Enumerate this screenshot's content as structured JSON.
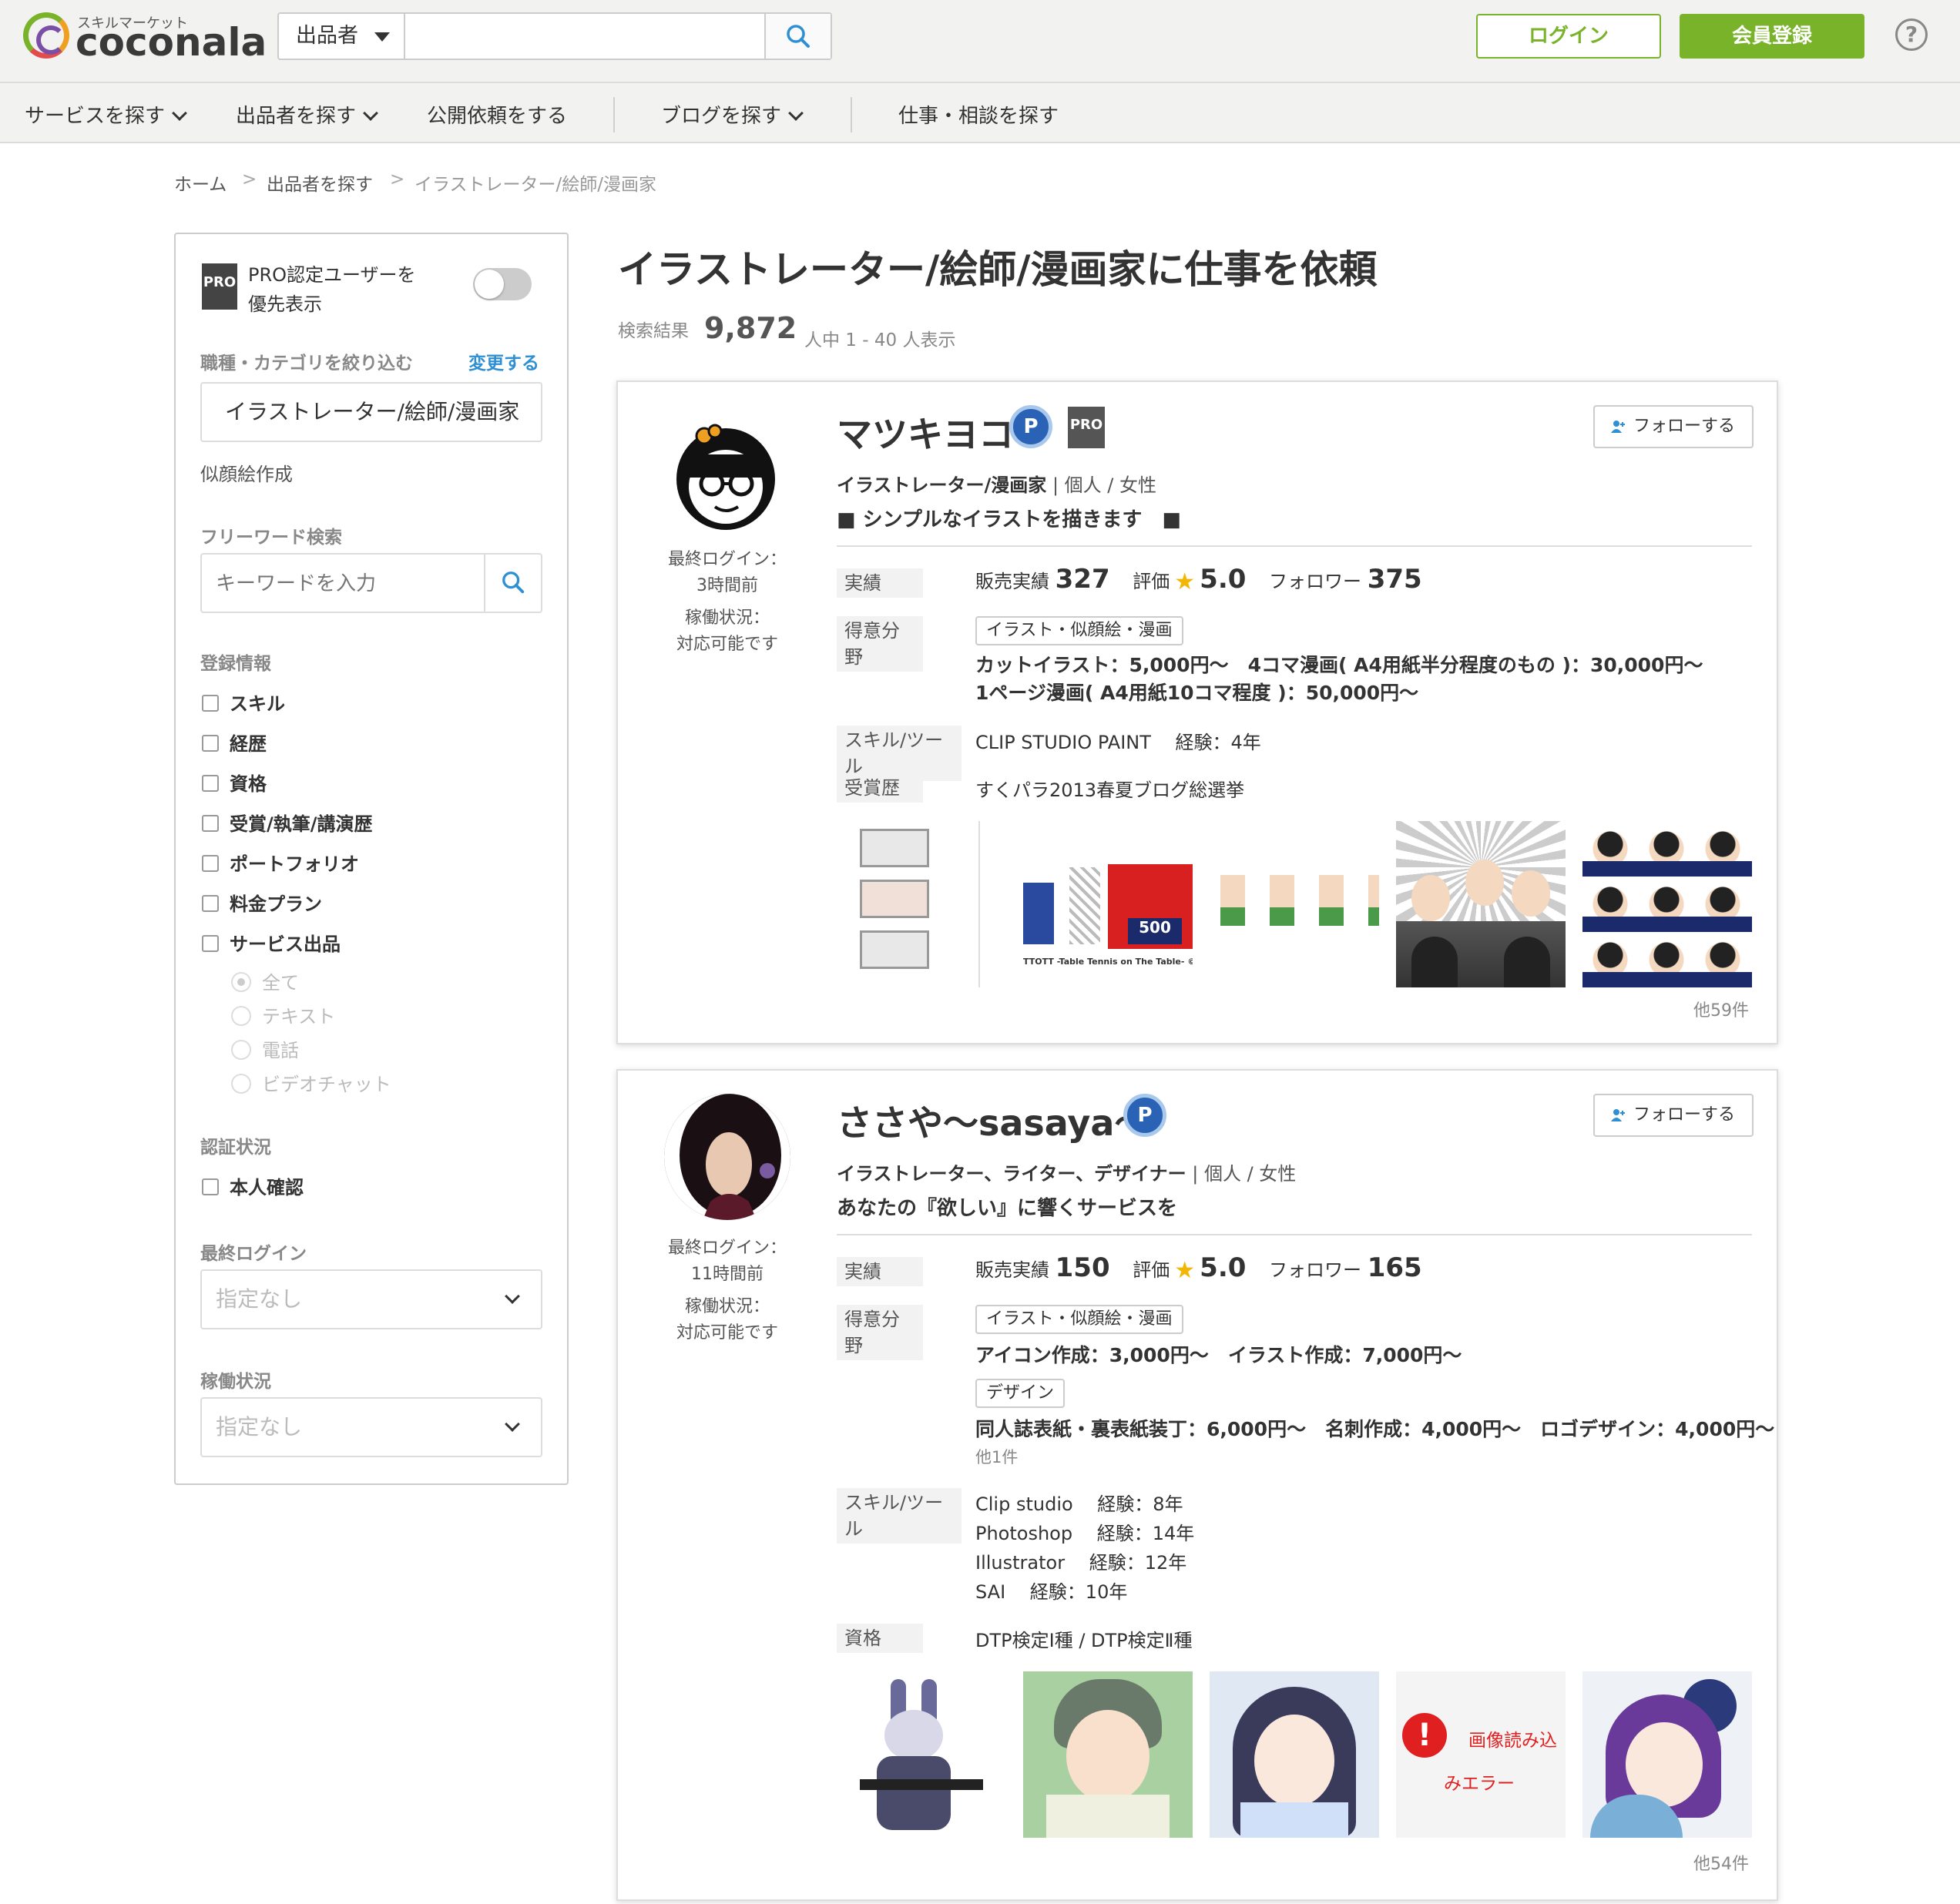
{
  "header": {
    "logo_sub": "スキルマーケット",
    "logo_text": "coconala",
    "search_type": "出品者",
    "login_label": "ログイン",
    "register_label": "会員登録",
    "help": "?",
    "brand_color": "#79b32a"
  },
  "nav": {
    "items": [
      "サービスを探す",
      "出品者を探す",
      "公開依頼をする",
      "ブログを探す",
      "仕事・相談を探す"
    ]
  },
  "breadcrumb": [
    "ホーム",
    ">",
    "出品者を探す",
    ">",
    "イラストレーター/絵師/漫画家"
  ],
  "sidebar": {
    "pro_toggle_label_1": "PRO認定ユーザーを",
    "pro_toggle_label_2": "優先表示",
    "pro_icon": "PRO",
    "category_label": "職種・カテゴリを絞り込む",
    "category_change": "変更する",
    "category_value": "イラストレーター/絵師/漫画家",
    "subcategory": "似顔絵作成",
    "freeword_label": "フリーワード検索",
    "freeword_placeholder": "キーワードを入力",
    "registration_label": "登録情報",
    "registration_items": [
      "スキル",
      "経歴",
      "資格",
      "受賞/執筆/講演歴",
      "ポートフォリオ",
      "料金プラン",
      "サービス出品"
    ],
    "service_types": [
      "全て",
      "テキスト",
      "電話",
      "ビデオチャット"
    ],
    "auth_label": "認証状況",
    "auth_item": "本人確認",
    "last_login_label": "最終ログイン",
    "last_login_value": "指定なし",
    "status_label": "稼働状況",
    "status_value": "指定なし"
  },
  "main": {
    "title": "イラストレーター/絵師/漫画家に仕事を依頼",
    "result_prefix": "検索結果",
    "result_count": "9,872",
    "result_suffix": "人中 1 - 40 人表示"
  },
  "cards": [
    {
      "name": "マツキヨコ",
      "pro_badge": "PRO",
      "rank_badge": "P",
      "follow": "フォローする",
      "role": "イラストレーター/漫画家",
      "type": "| 個人 / 女性",
      "catch": "■ シンプルなイラストを描きます　■",
      "last_login_label": "最終ログイン：",
      "last_login": "3時間前",
      "status_label": "稼働状況：",
      "status": "対応可能です",
      "stats_label": "実績",
      "sales_label": "販売実績",
      "sales": "327",
      "rating_label": "評価",
      "rating": "5.0",
      "followers_label": "フォロワー",
      "followers": "375",
      "field_label": "得意分野",
      "field_tag": "イラスト・似顔絵・漫画",
      "field_line1": "カットイラスト：5,000円〜　4コマ漫画( A4用紙半分程度のもの )：30,000円〜",
      "field_line2": "1ページ漫画( A4用紙10コマ程度 )：50,000円〜",
      "skill_label": "スキル/ツール",
      "skill": "CLIP STUDIO PAINT　 経験：4年",
      "award_label": "受賞歴",
      "award": "すくパラ2013春夏ブログ総選挙",
      "thumb_caption": "TTOTT -Table Tennis on The Table- ©",
      "more": "他59件"
    },
    {
      "name": "ささや〜sasaya〜",
      "rank_badge": "P",
      "follow": "フォローする",
      "role": "イラストレーター、ライター、デザイナー",
      "type": "| 個人 / 女性",
      "catch": "あなたの『欲しい』に響くサービスを",
      "last_login_label": "最終ログイン：",
      "last_login": "11時間前",
      "status_label": "稼働状況：",
      "status": "対応可能です",
      "stats_label": "実績",
      "sales_label": "販売実績",
      "sales": "150",
      "rating_label": "評価",
      "rating": "5.0",
      "followers_label": "フォロワー",
      "followers": "165",
      "field_label": "得意分野",
      "field_tag": "イラスト・似顔絵・漫画",
      "field_line1": "アイコン作成：3,000円〜　イラスト作成：7,000円〜",
      "field_tag2": "デザイン",
      "field_line2": "同人誌表紙・裏表紙装丁：6,000円〜　名刺作成：4,000円〜　ロゴデザイン：4,000円〜",
      "field_more": "他1件",
      "skill_label": "スキル/ツール",
      "skills": [
        "Clip studio　 経験：8年",
        "Photoshop　 経験：14年",
        "Illustrator　 経験：12年",
        "SAI　 経験：10年"
      ],
      "cert_label": "資格",
      "cert": "DTP検定Ⅰ種 / DTP検定Ⅱ種",
      "error_text_1": "画像読み込",
      "error_text_2": "みエラー",
      "more": "他54件"
    }
  ]
}
